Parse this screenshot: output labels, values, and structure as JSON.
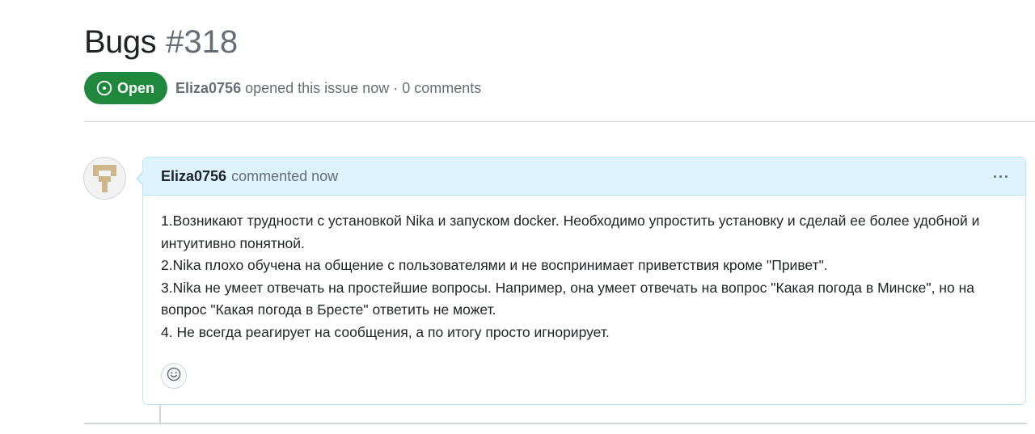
{
  "issue": {
    "title": "Bugs",
    "number": "#318",
    "state_label": "Open",
    "author": "Eliza0756",
    "meta_text": "opened this issue now · 0 comments"
  },
  "comment": {
    "author": "Eliza0756",
    "action_text": "commented now",
    "paragraphs": [
      "1.Возникают трудности с установкой Nika и запуском docker. Необходимо упростить установку и сделай ее более удобной и интуитивно понятной.",
      "2.Nika плохо обучена на общение с пользователями и не воспринимает приветствия кроме \"Привет\".",
      "3.Nika не умеет отвечать на простейшие вопросы. Например, она умеет отвечать на вопрос \"Какая погода в Минске\", но на вопрос \"Какая погода в Бресте\" ответить не может.",
      "4. Не всегда реагирует на сообщения, а по итогу просто игнорирует."
    ]
  },
  "icons": {
    "state": "issue-open-icon",
    "more": "kebab-horizontal-icon",
    "reaction": "smiley-icon"
  },
  "colors": {
    "open_badge": "#1f883d",
    "comment_header_bg": "#ddf4ff",
    "comment_border": "#b6e3ff",
    "avatar_pattern": "#cdb68a"
  }
}
